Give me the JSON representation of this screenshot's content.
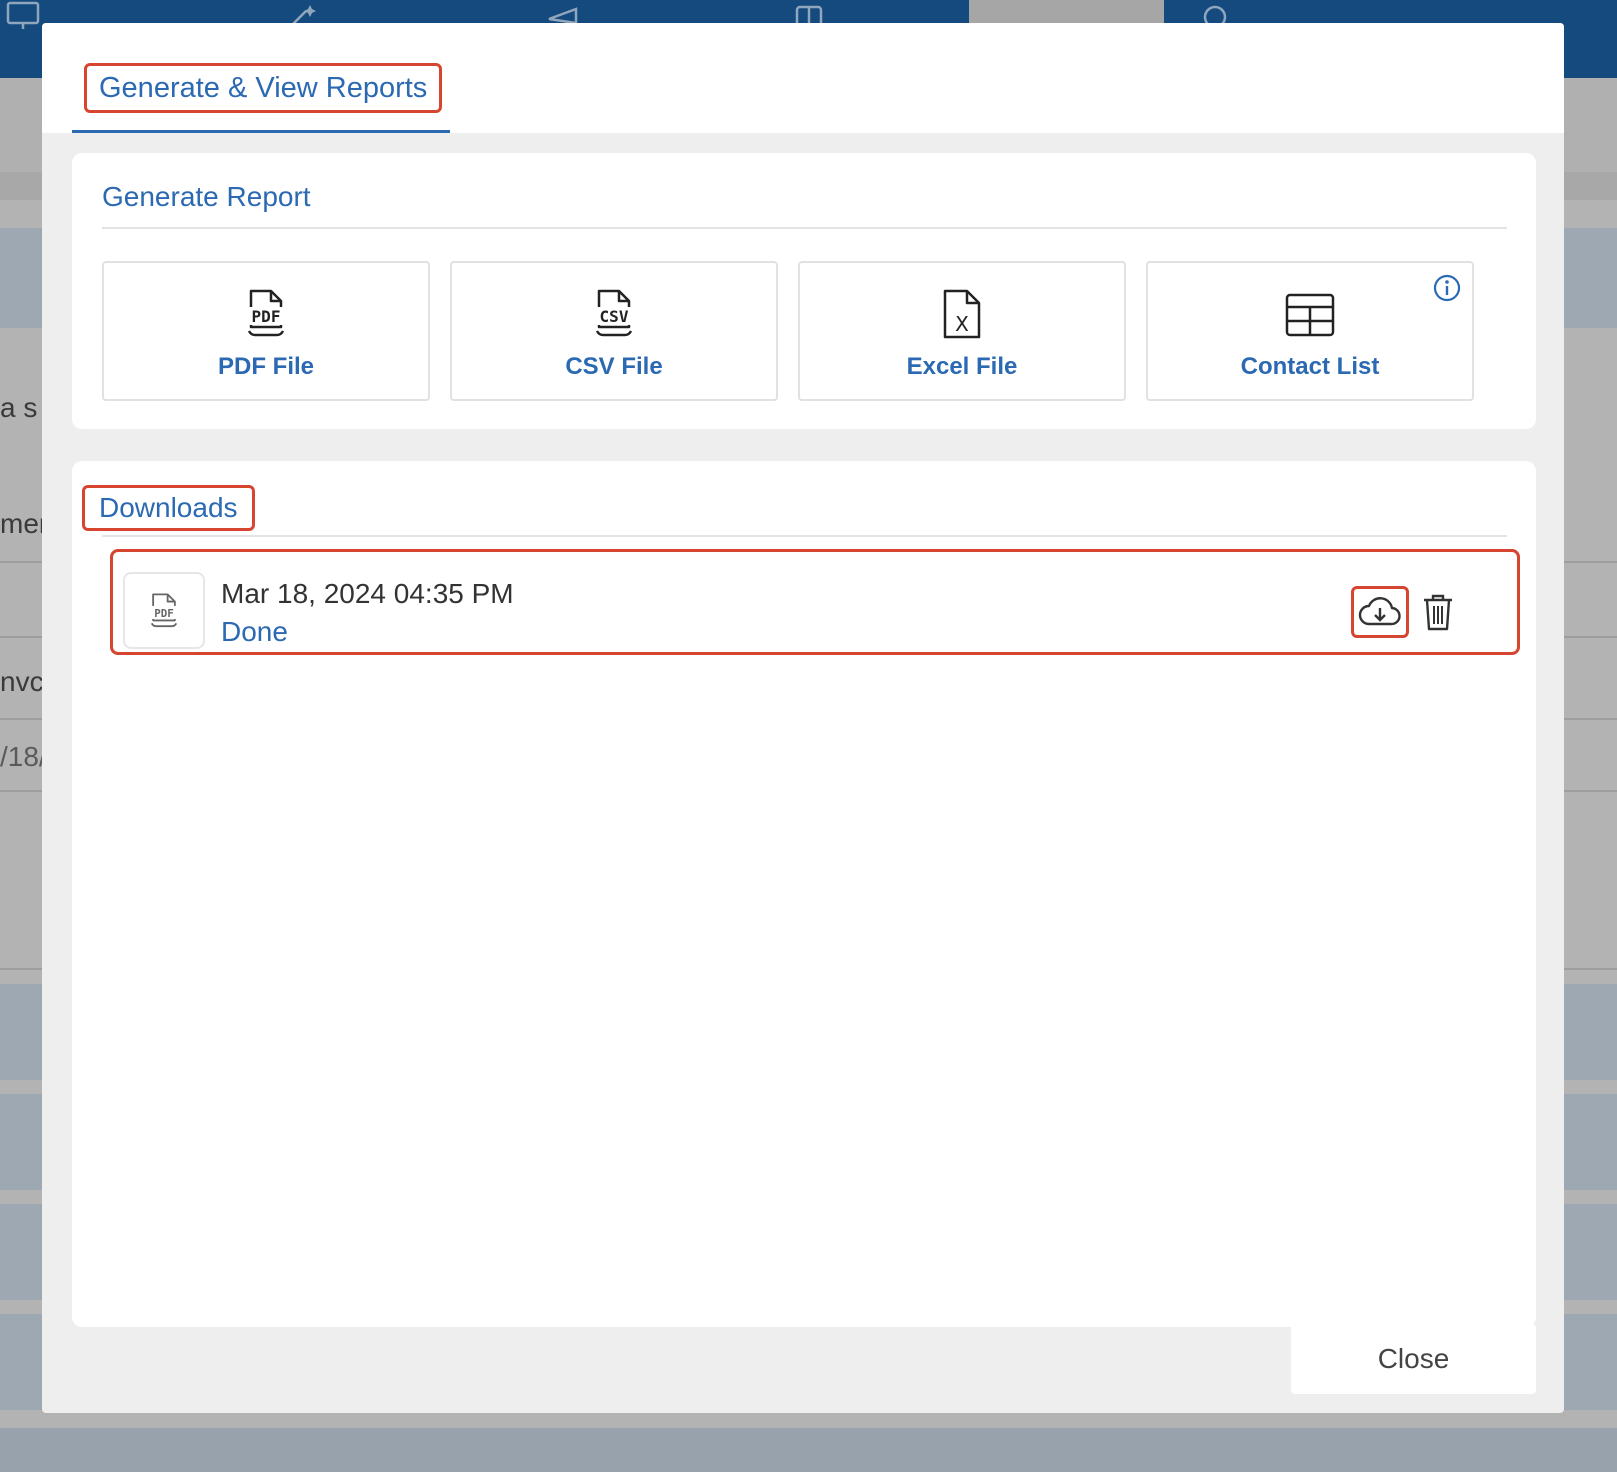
{
  "modal": {
    "tab_label": "Generate & View Reports",
    "generate": {
      "title": "Generate Report",
      "buttons": [
        {
          "label": "PDF File",
          "icon": "pdf-file-icon"
        },
        {
          "label": "CSV File",
          "icon": "csv-file-icon"
        },
        {
          "label": "Excel File",
          "icon": "excel-file-icon"
        },
        {
          "label": "Contact List",
          "icon": "table-icon"
        }
      ],
      "file_icon_labels": {
        "pdf": "PDF",
        "csv": "CSV",
        "excel": "X"
      }
    },
    "downloads": {
      "title": "Downloads",
      "items": [
        {
          "date": "Mar 18, 2024 04:35 PM",
          "status": "Done",
          "file_icon_label": "PDF"
        }
      ]
    },
    "close_label": "Close"
  },
  "background": {
    "snippets": [
      "a s",
      "men",
      "nvc",
      "/18/"
    ]
  },
  "colors": {
    "accent": "#2b69b3",
    "highlight": "#d6452f",
    "topbar": "#144a7d",
    "modal_bg": "#eeeeee"
  }
}
